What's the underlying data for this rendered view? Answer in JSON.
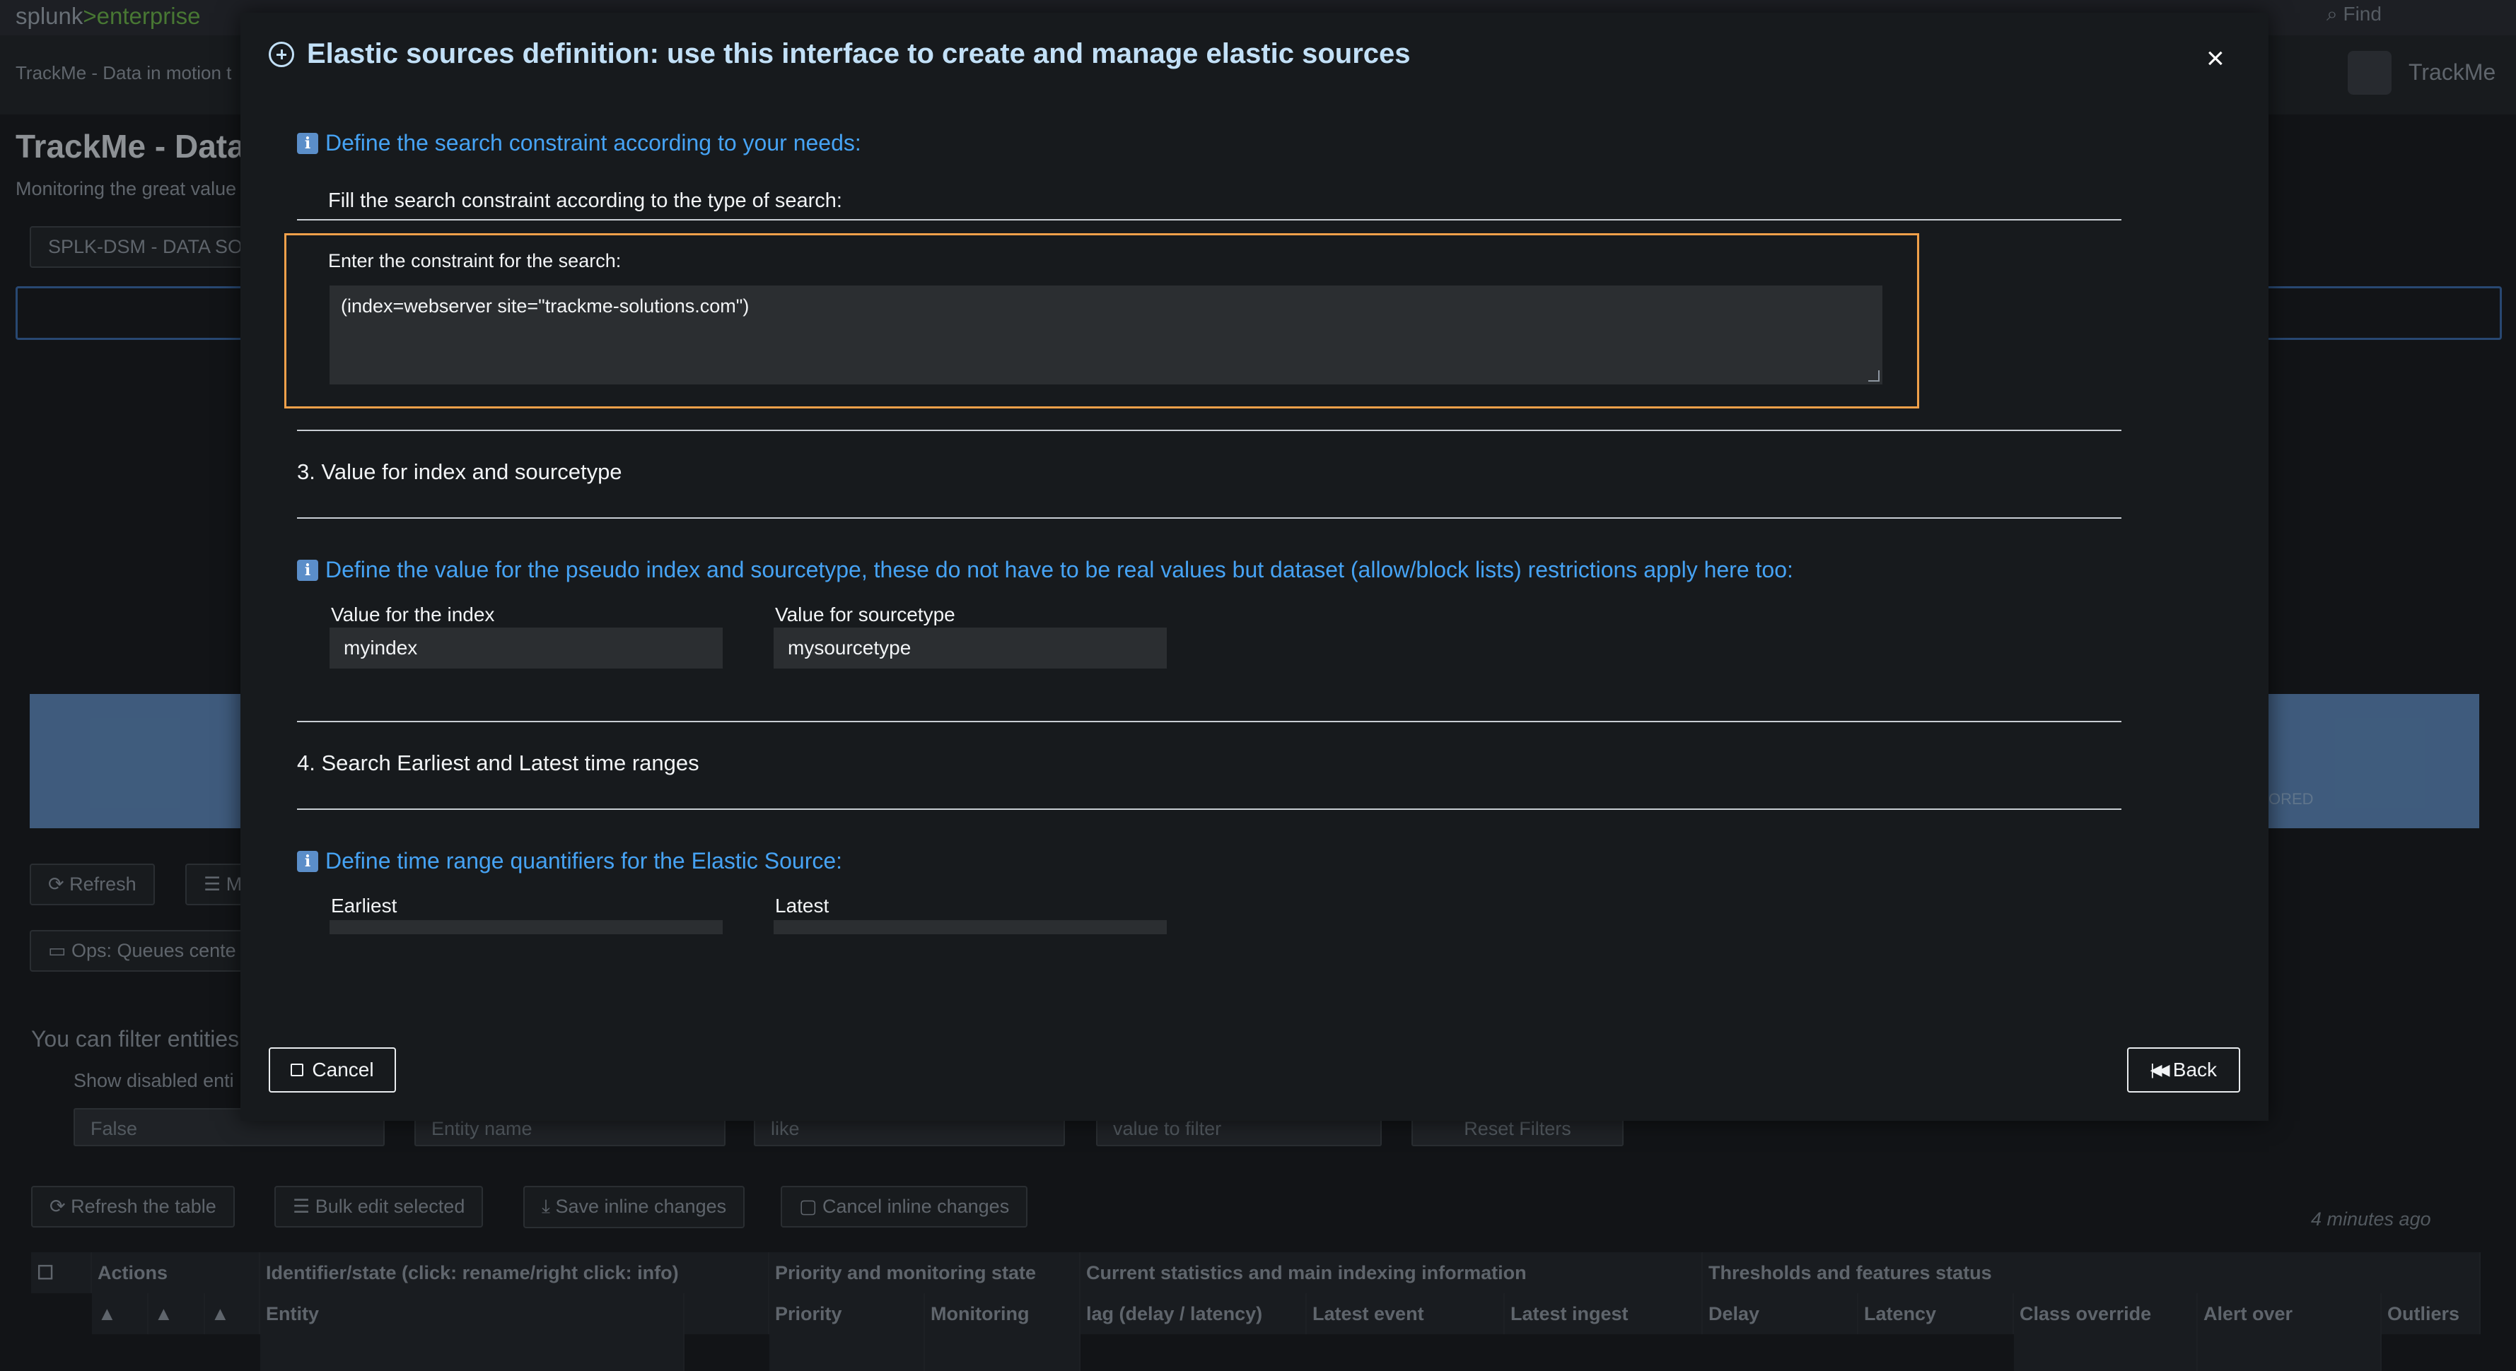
{
  "background": {
    "logo_main": "splunk",
    "logo_sep": ">",
    "logo_product": "enterprise",
    "find_label": "Find",
    "breadcrumb": "TrackMe - Data in motion t",
    "brand_name": "TrackMe",
    "page_title": "TrackMe - Data",
    "page_subtitle": "Monitoring the great value",
    "tab_label": "SPLK-DSM - DATA SO",
    "stat_label": "ORED",
    "refresh_button": "Refresh",
    "m_button": "M",
    "ops_button": "Ops: Queues cente",
    "filter_title": "You can filter entities",
    "show_disabled_label": "Show disabled enti",
    "filters": {
      "disabled_value": "False",
      "entity_placeholder": "Entity name",
      "operator_value": "like",
      "value_placeholder": "value to filter",
      "reset_label": "Reset Filters"
    },
    "toolbar": {
      "refresh_table": "Refresh the table",
      "bulk_edit": "Bulk edit selected",
      "save_inline": "Save inline changes",
      "cancel_inline": "Cancel inline changes"
    },
    "time_ago": "4 minutes ago",
    "table": {
      "groups": [
        "Actions",
        "Identifier/state (click: rename/right click: info)",
        "Priority and monitoring state",
        "Current statistics and main indexing information",
        "Thresholds and features status"
      ],
      "columns": [
        "Entity",
        "Priority",
        "Monitoring",
        "lag (delay / latency)",
        "Latest event",
        "Latest ingest",
        "Delay",
        "Latency",
        "Class override",
        "Alert over",
        "Outliers"
      ]
    }
  },
  "modal": {
    "title": "Elastic sources definition: use this interface to create and manage elastic sources",
    "close_symbol": "×",
    "info_constraint": "Define the search constraint according to your needs:",
    "fill_instruction": "Fill the search constraint according to the type of search:",
    "constraint_label": "Enter the constraint for the search:",
    "constraint_value": "(index=webserver site=\"trackme-solutions.com\")",
    "section3_title": "3. Value for index and sourcetype",
    "info_pseudo": "Define the value for the pseudo index and sourcetype, these do not have to be real values but dataset (allow/block lists) restrictions apply here too:",
    "index_label": "Value for the index",
    "index_value": "myindex",
    "sourcetype_label": "Value for sourcetype",
    "sourcetype_value": "mysourcetype",
    "section4_title": "4. Search Earliest and Latest time ranges",
    "info_time": "Define time range quantifiers for the Elastic Source:",
    "earliest_label": "Earliest",
    "latest_label": "Latest",
    "cancel_label": "Cancel",
    "back_label": "Back"
  }
}
